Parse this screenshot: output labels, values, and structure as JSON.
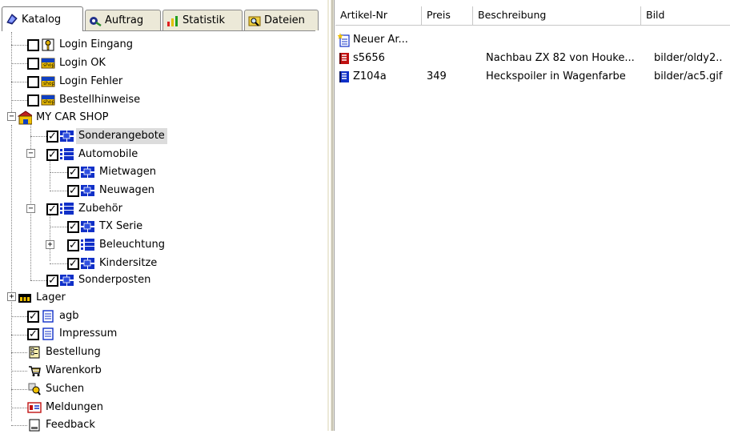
{
  "tabs": [
    {
      "label": "Katalog",
      "icon": "catalog-icon",
      "active": true
    },
    {
      "label": "Auftrag",
      "icon": "order-icon",
      "active": false
    },
    {
      "label": "Statistik",
      "icon": "chart-icon",
      "active": false
    },
    {
      "label": "Dateien",
      "icon": "folder-search-icon",
      "active": false
    }
  ],
  "tree": {
    "login_eingang": "Login Eingang",
    "login_ok": "Login OK",
    "login_fehler": "Login Fehler",
    "bestellhinweise": "Bestellhinweise",
    "my_car_shop": "MY CAR SHOP",
    "sonderangebote": "Sonderangebote",
    "automobile": "Automobile",
    "mietwagen": "Mietwagen",
    "neuwagen": "Neuwagen",
    "zubehoer": "Zubehör",
    "tx_serie": "TX Serie",
    "beleuchtung": "Beleuchtung",
    "kindersitze": "Kindersitze",
    "sonderposten": "Sonderposten",
    "lager": "Lager",
    "agb": "agb",
    "impressum": "Impressum",
    "bestellung": "Bestellung",
    "warenkorb": "Warenkorb",
    "suchen": "Suchen",
    "meldungen": "Meldungen",
    "feedback": "Feedback"
  },
  "list": {
    "columns": [
      "Artikel-Nr",
      "Preis",
      "Beschreibung",
      "Bild"
    ],
    "rows": [
      {
        "artikel": "Neuer Ar...",
        "preis": "",
        "beschreibung": "",
        "bild": ""
      },
      {
        "artikel": "s5656",
        "preis": "",
        "beschreibung": "Nachbau ZX 82 von Houke...",
        "bild": "bilder/oldy2.."
      },
      {
        "artikel": "Z104a",
        "preis": "349",
        "beschreibung": "Heckspoiler in Wagenfarbe",
        "bild": "bilder/ac5.gif"
      }
    ]
  },
  "colors": {
    "selected_bg": "#dcdcdc",
    "shop_yellow": "#f0c000",
    "item_blue": "#1030c8",
    "tab_bg": "#ece9d8"
  }
}
